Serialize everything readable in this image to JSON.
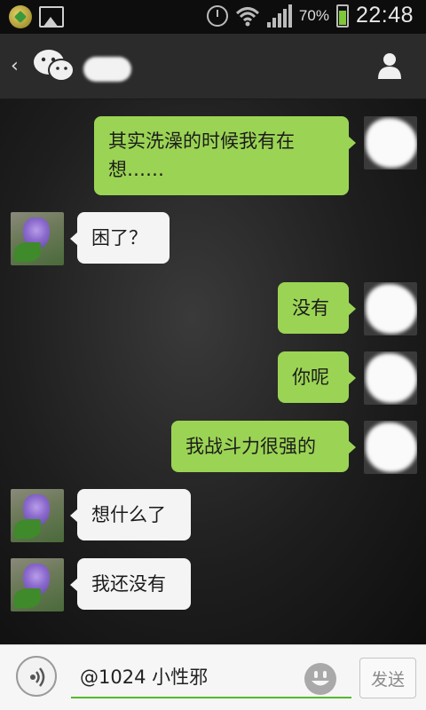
{
  "status_bar": {
    "battery_percent": "70%",
    "time": "22:48",
    "icons": [
      "app-notification-icon",
      "gallery-icon",
      "alarm-icon",
      "wifi-icon",
      "signal-icon",
      "battery-charging-icon"
    ]
  },
  "header": {
    "back_icon": "‹",
    "app_icon": "wechat-icon",
    "contact_icon": "person-icon"
  },
  "messages": [
    {
      "side": "me",
      "text": "其实洗澡的时候我有在想……"
    },
    {
      "side": "other",
      "text": "困了？"
    },
    {
      "side": "me",
      "text": "没有"
    },
    {
      "side": "me",
      "text": "你呢"
    },
    {
      "side": "me",
      "text": "我战斗力很强的"
    },
    {
      "side": "other",
      "text": "想什么了"
    },
    {
      "side": "other",
      "text": "我还没有"
    }
  ],
  "input_bar": {
    "value": "@1024 小性邪",
    "send_label": "发送",
    "voice_icon": "voice-icon",
    "emoji_icon": "emoji-icon"
  },
  "colors": {
    "my_bubble": "#9bd454",
    "other_bubble": "#f4f4f4",
    "input_underline": "#54b82c"
  }
}
